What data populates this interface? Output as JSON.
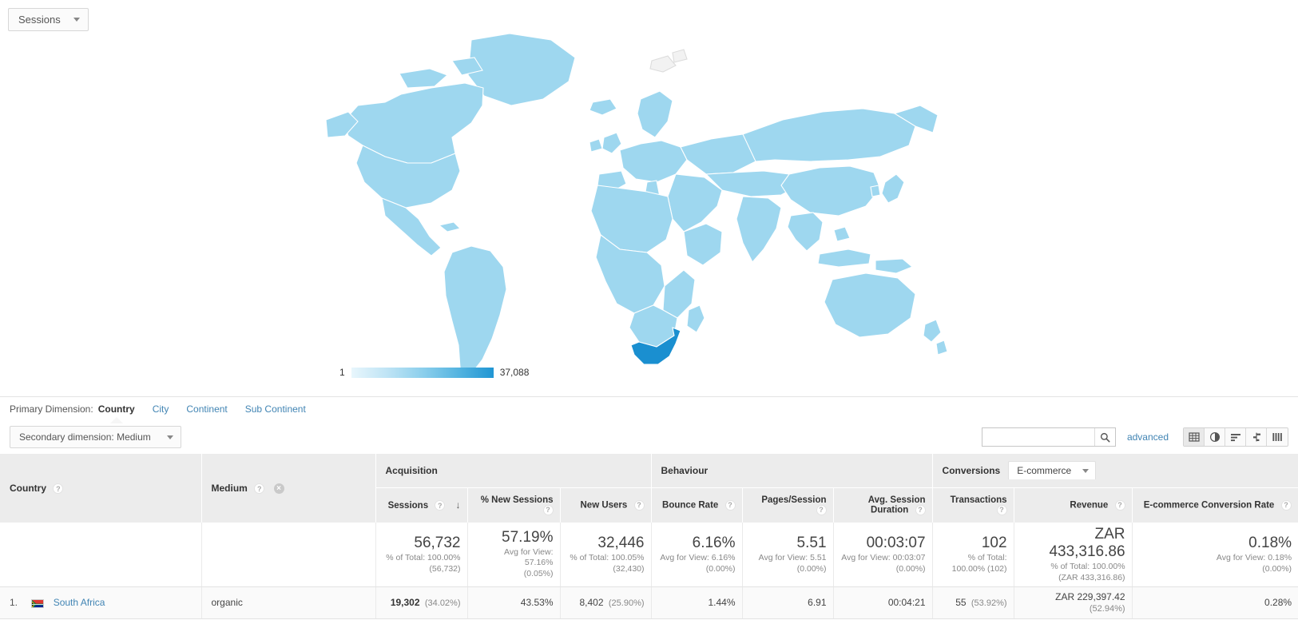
{
  "metric_selector": {
    "label": "Sessions",
    "icon": "chevron-down-icon"
  },
  "map": {
    "legend_min": "1",
    "legend_max": "37,088",
    "highlight_country": "South Africa",
    "base_color": "#9ed7ef",
    "highlight_color": "#1a8fd0",
    "stroke_color": "#ffffff"
  },
  "primary_dimension": {
    "label": "Primary Dimension:",
    "items": [
      {
        "label": "Country",
        "active": true
      },
      {
        "label": "City",
        "active": false
      },
      {
        "label": "Continent",
        "active": false
      },
      {
        "label": "Sub Continent",
        "active": false
      }
    ]
  },
  "controls": {
    "secondary_dimension_label": "Secondary dimension: Medium",
    "search_value": "",
    "search_placeholder": "",
    "search_icon": "search-icon",
    "advanced_label": "advanced",
    "view_icons": [
      {
        "name": "table-view-icon",
        "active": true
      },
      {
        "name": "pie-chart-view-icon",
        "active": false
      },
      {
        "name": "performance-view-icon",
        "active": false
      },
      {
        "name": "comparison-view-icon",
        "active": false
      },
      {
        "name": "pivot-view-icon",
        "active": false
      }
    ]
  },
  "table": {
    "group_headers": {
      "acquisition": "Acquisition",
      "behaviour": "Behaviour",
      "conversions": "Conversions",
      "conversions_tab": "E-commerce"
    },
    "dimension_headers": {
      "country": "Country",
      "medium": "Medium"
    },
    "metric_headers": [
      "Sessions",
      "% New Sessions",
      "New Users",
      "Bounce Rate",
      "Pages/Session",
      "Avg. Session Duration",
      "Transactions",
      "Revenue",
      "E-commerce Conversion Rate"
    ],
    "sort_column": "Sessions",
    "sort_direction": "desc",
    "totals": [
      {
        "value": "56,732",
        "sub1": "% of Total: 100.00%",
        "sub2": "(56,732)"
      },
      {
        "value": "57.19%",
        "sub1": "Avg for View: 57.16%",
        "sub2": "(0.05%)"
      },
      {
        "value": "32,446",
        "sub1": "% of Total: 100.05%",
        "sub2": "(32,430)"
      },
      {
        "value": "6.16%",
        "sub1": "Avg for View: 6.16%",
        "sub2": "(0.00%)"
      },
      {
        "value": "5.51",
        "sub1": "Avg for View: 5.51",
        "sub2": "(0.00%)"
      },
      {
        "value": "00:03:07",
        "sub1": "Avg for View: 00:03:07",
        "sub2": "(0.00%)"
      },
      {
        "value": "102",
        "sub1": "% of Total:",
        "sub2": "100.00% (102)"
      },
      {
        "value": "ZAR 433,316.86",
        "sub1": "% of Total: 100.00%",
        "sub2": "(ZAR 433,316.86)"
      },
      {
        "value": "0.18%",
        "sub1": "Avg for View: 0.18%",
        "sub2": "(0.00%)"
      }
    ],
    "rows": [
      {
        "index": "1.",
        "country": "South Africa",
        "flag": "south-africa-flag",
        "medium": "organic",
        "cells": [
          {
            "value": "19,302",
            "pct": "(34.02%)",
            "strong": true
          },
          {
            "value": "43.53%",
            "pct": "",
            "strong": false
          },
          {
            "value": "8,402",
            "pct": "(25.90%)",
            "strong": false
          },
          {
            "value": "1.44%",
            "pct": "",
            "strong": false
          },
          {
            "value": "6.91",
            "pct": "",
            "strong": false
          },
          {
            "value": "00:04:21",
            "pct": "",
            "strong": false
          },
          {
            "value": "55",
            "pct": "(53.92%)",
            "strong": false
          },
          {
            "value": "ZAR 229,397.42",
            "pct": "(52.94%)",
            "strong": false
          },
          {
            "value": "0.28%",
            "pct": "",
            "strong": false
          }
        ]
      }
    ]
  }
}
